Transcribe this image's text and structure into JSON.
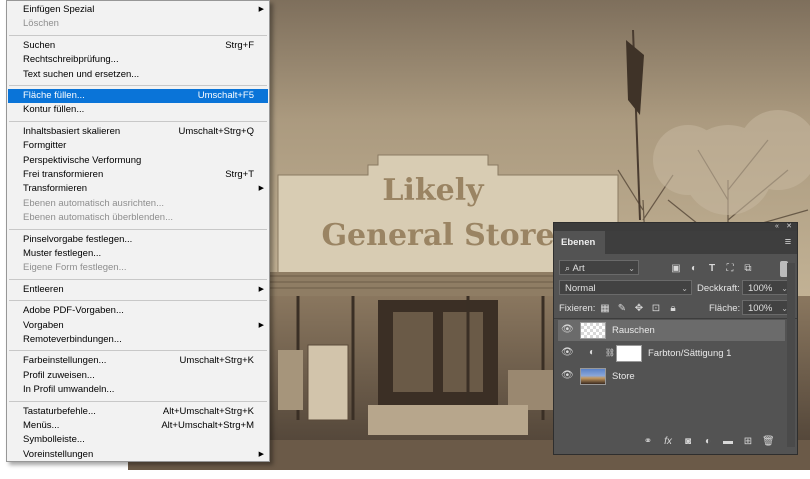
{
  "menu": {
    "items": [
      {
        "label": "Einfügen Spezial",
        "shortcut": "",
        "submenu": true,
        "disabled": false,
        "highlight": false
      },
      {
        "label": "Löschen",
        "shortcut": "",
        "submenu": false,
        "disabled": true,
        "highlight": false
      },
      {
        "sep": true
      },
      {
        "label": "Suchen",
        "shortcut": "Strg+F",
        "submenu": false,
        "disabled": false,
        "highlight": false
      },
      {
        "label": "Rechtschreibprüfung...",
        "shortcut": "",
        "submenu": false,
        "disabled": false,
        "highlight": false
      },
      {
        "label": "Text suchen und ersetzen...",
        "shortcut": "",
        "submenu": false,
        "disabled": false,
        "highlight": false
      },
      {
        "sep": true
      },
      {
        "label": "Fläche füllen...",
        "shortcut": "Umschalt+F5",
        "submenu": false,
        "disabled": false,
        "highlight": true
      },
      {
        "label": "Kontur füllen...",
        "shortcut": "",
        "submenu": false,
        "disabled": false,
        "highlight": false
      },
      {
        "sep": true
      },
      {
        "label": "Inhaltsbasiert skalieren",
        "shortcut": "Umschalt+Strg+Q",
        "submenu": false,
        "disabled": false,
        "highlight": false
      },
      {
        "label": "Formgitter",
        "shortcut": "",
        "submenu": false,
        "disabled": false,
        "highlight": false
      },
      {
        "label": "Perspektivische Verformung",
        "shortcut": "",
        "submenu": false,
        "disabled": false,
        "highlight": false
      },
      {
        "label": "Frei transformieren",
        "shortcut": "Strg+T",
        "submenu": false,
        "disabled": false,
        "highlight": false
      },
      {
        "label": "Transformieren",
        "shortcut": "",
        "submenu": true,
        "disabled": false,
        "highlight": false
      },
      {
        "label": "Ebenen automatisch ausrichten...",
        "shortcut": "",
        "submenu": false,
        "disabled": true,
        "highlight": false
      },
      {
        "label": "Ebenen automatisch überblenden...",
        "shortcut": "",
        "submenu": false,
        "disabled": true,
        "highlight": false
      },
      {
        "sep": true
      },
      {
        "label": "Pinselvorgabe festlegen...",
        "shortcut": "",
        "submenu": false,
        "disabled": false,
        "highlight": false
      },
      {
        "label": "Muster festlegen...",
        "shortcut": "",
        "submenu": false,
        "disabled": false,
        "highlight": false
      },
      {
        "label": "Eigene Form festlegen...",
        "shortcut": "",
        "submenu": false,
        "disabled": true,
        "highlight": false
      },
      {
        "sep": true
      },
      {
        "label": "Entleeren",
        "shortcut": "",
        "submenu": true,
        "disabled": false,
        "highlight": false
      },
      {
        "sep": true
      },
      {
        "label": "Adobe PDF-Vorgaben...",
        "shortcut": "",
        "submenu": false,
        "disabled": false,
        "highlight": false
      },
      {
        "label": "Vorgaben",
        "shortcut": "",
        "submenu": true,
        "disabled": false,
        "highlight": false
      },
      {
        "label": "Remoteverbindungen...",
        "shortcut": "",
        "submenu": false,
        "disabled": false,
        "highlight": false
      },
      {
        "sep": true
      },
      {
        "label": "Farbeinstellungen...",
        "shortcut": "Umschalt+Strg+K",
        "submenu": false,
        "disabled": false,
        "highlight": false
      },
      {
        "label": "Profil zuweisen...",
        "shortcut": "",
        "submenu": false,
        "disabled": false,
        "highlight": false
      },
      {
        "label": "In Profil umwandeln...",
        "shortcut": "",
        "submenu": false,
        "disabled": false,
        "highlight": false
      },
      {
        "sep": true
      },
      {
        "label": "Tastaturbefehle...",
        "shortcut": "Alt+Umschalt+Strg+K",
        "submenu": false,
        "disabled": false,
        "highlight": false
      },
      {
        "label": "Menüs...",
        "shortcut": "Alt+Umschalt+Strg+M",
        "submenu": false,
        "disabled": false,
        "highlight": false
      },
      {
        "label": "Symbolleiste...",
        "shortcut": "",
        "submenu": false,
        "disabled": false,
        "highlight": false
      },
      {
        "label": "Voreinstellungen",
        "shortcut": "",
        "submenu": true,
        "disabled": false,
        "highlight": false
      }
    ]
  },
  "photo": {
    "sign_line1": "Likely",
    "sign_line2": "General Store"
  },
  "layers": {
    "tab": "Ebenen",
    "filter_kind": "Art",
    "blend_mode": "Normal",
    "opacity_label": "Deckkraft:",
    "opacity_value": "100%",
    "lock_label": "Fixieren:",
    "fill_label": "Fläche:",
    "fill_value": "100%",
    "items": [
      {
        "name": "Rauschen",
        "selected": true
      },
      {
        "name": "Farbton/Sättigung 1",
        "selected": false
      },
      {
        "name": "Store",
        "selected": false
      }
    ]
  },
  "colors": {
    "menu_highlight": "#0a74d8",
    "panel_bg": "#535353",
    "selected_layer": "#6b6b6b"
  }
}
